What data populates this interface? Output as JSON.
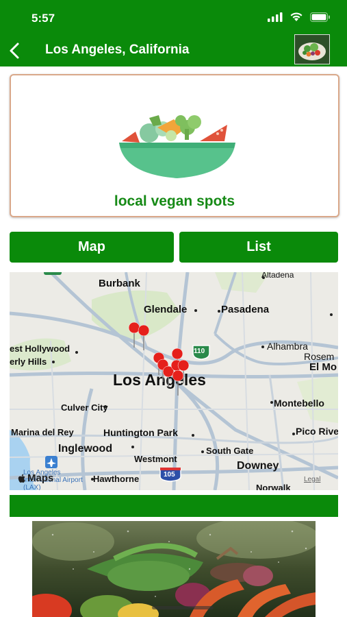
{
  "status": {
    "time": "5:57"
  },
  "nav": {
    "title": "Los Angeles, California"
  },
  "hero": {
    "caption": "local vegan spots"
  },
  "segments": {
    "map_label": "Map",
    "list_label": "List"
  },
  "map": {
    "labels": {
      "altadena": "Altadena",
      "burbank": "Burbank",
      "glendale": "Glendale",
      "pasadena": "Pasadena",
      "west_hollywood": "est Hollywood",
      "beverly_hills": "erly Hills",
      "alhambra": "Alhambra",
      "rosemead": "Rosem",
      "el_monte": "El Mo",
      "los_angeles": "Los Angeles",
      "culver_city": "Culver City",
      "montebello": "Montebello",
      "marina_del_rey": "Marina del Rey",
      "huntington_park": "Huntington Park",
      "pico_rivera": "Pico Rive",
      "inglewood": "Inglewood",
      "south_gate": "South Gate",
      "westmont": "Westmont",
      "downey": "Downey",
      "hawthorne": "Hawthorne",
      "norwalk": "Norwalk",
      "lax": "Los Angeles International Airport (LAX)",
      "maps_logo": "Maps",
      "legal": "Legal",
      "route_110": "110",
      "route_105": "105"
    }
  },
  "colors": {
    "primary": "#0a8a0a",
    "caption": "#168a16",
    "pin": "#e5201b"
  }
}
